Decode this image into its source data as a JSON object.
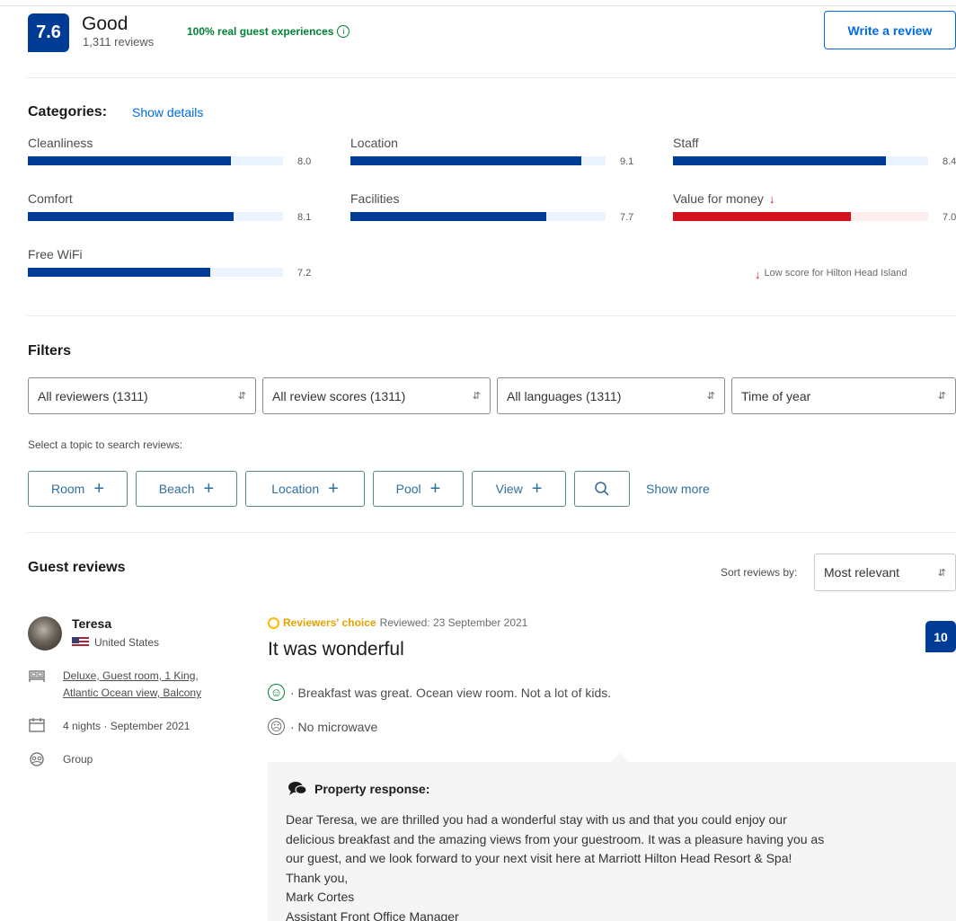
{
  "header": {
    "score": "7.6",
    "score_word": "Good",
    "review_count": "1,311 reviews",
    "real_guest": "100% real guest experiences",
    "write_review": "Write a review"
  },
  "categories": {
    "title": "Categories:",
    "show_details": "Show details",
    "items": [
      {
        "label": "Cleanliness",
        "score": "8.0",
        "value": 8.0
      },
      {
        "label": "Location",
        "score": "9.1",
        "value": 9.1
      },
      {
        "label": "Staff",
        "score": "8.4",
        "value": 8.4
      },
      {
        "label": "Comfort",
        "score": "8.1",
        "value": 8.1
      },
      {
        "label": "Facilities",
        "score": "7.7",
        "value": 7.7
      },
      {
        "label": "Value for money",
        "score": "7.0",
        "value": 7.0,
        "low": true
      },
      {
        "label": "Free WiFi",
        "score": "7.2",
        "value": 7.2
      }
    ],
    "low_score_note": "Low score for Hilton Head Island",
    "colors": {
      "fill": "#003b95",
      "track": "#ebf3ff",
      "low_fill": "#d4111e"
    }
  },
  "filters": {
    "title": "Filters",
    "selects": [
      "All reviewers (1311)",
      "All review scores (1311)",
      "All languages (1311)",
      "Time of year"
    ],
    "topic_caption": "Select a topic to search reviews:",
    "topics": [
      "Room",
      "Beach",
      "Location",
      "Pool",
      "View"
    ],
    "show_more": "Show more"
  },
  "reviews": {
    "title": "Guest reviews",
    "sort_label": "Sort reviews by:",
    "sort_value": "Most relevant",
    "items": [
      {
        "name": "Teresa",
        "country": "United States",
        "room_line1": "Deluxe, Guest room, 1 King,",
        "room_line2": "Atlantic Ocean view, Balcony",
        "stay": "4 nights · September 2021",
        "group": "Group",
        "badge": "Reviewers' choice",
        "reviewed": "Reviewed: 23 September 2021",
        "title": "It was wonderful",
        "score": "10",
        "positive": "· Breakfast was great. Ocean view room. Not a lot of kids.",
        "negative": "· No microwave",
        "response_title": "Property response:",
        "response_lines": [
          "Dear Teresa, we are thrilled you had a wonderful stay with us and that you could enjoy our",
          "delicious breakfast and the amazing views from your guestroom. It was a pleasure having you as",
          "our guest, and we look forward to your next visit here at Marriott Hilton Head Resort & Spa!",
          "Thank you,",
          "Mark Cortes",
          "Assistant Front Office Manager"
        ]
      }
    ]
  }
}
